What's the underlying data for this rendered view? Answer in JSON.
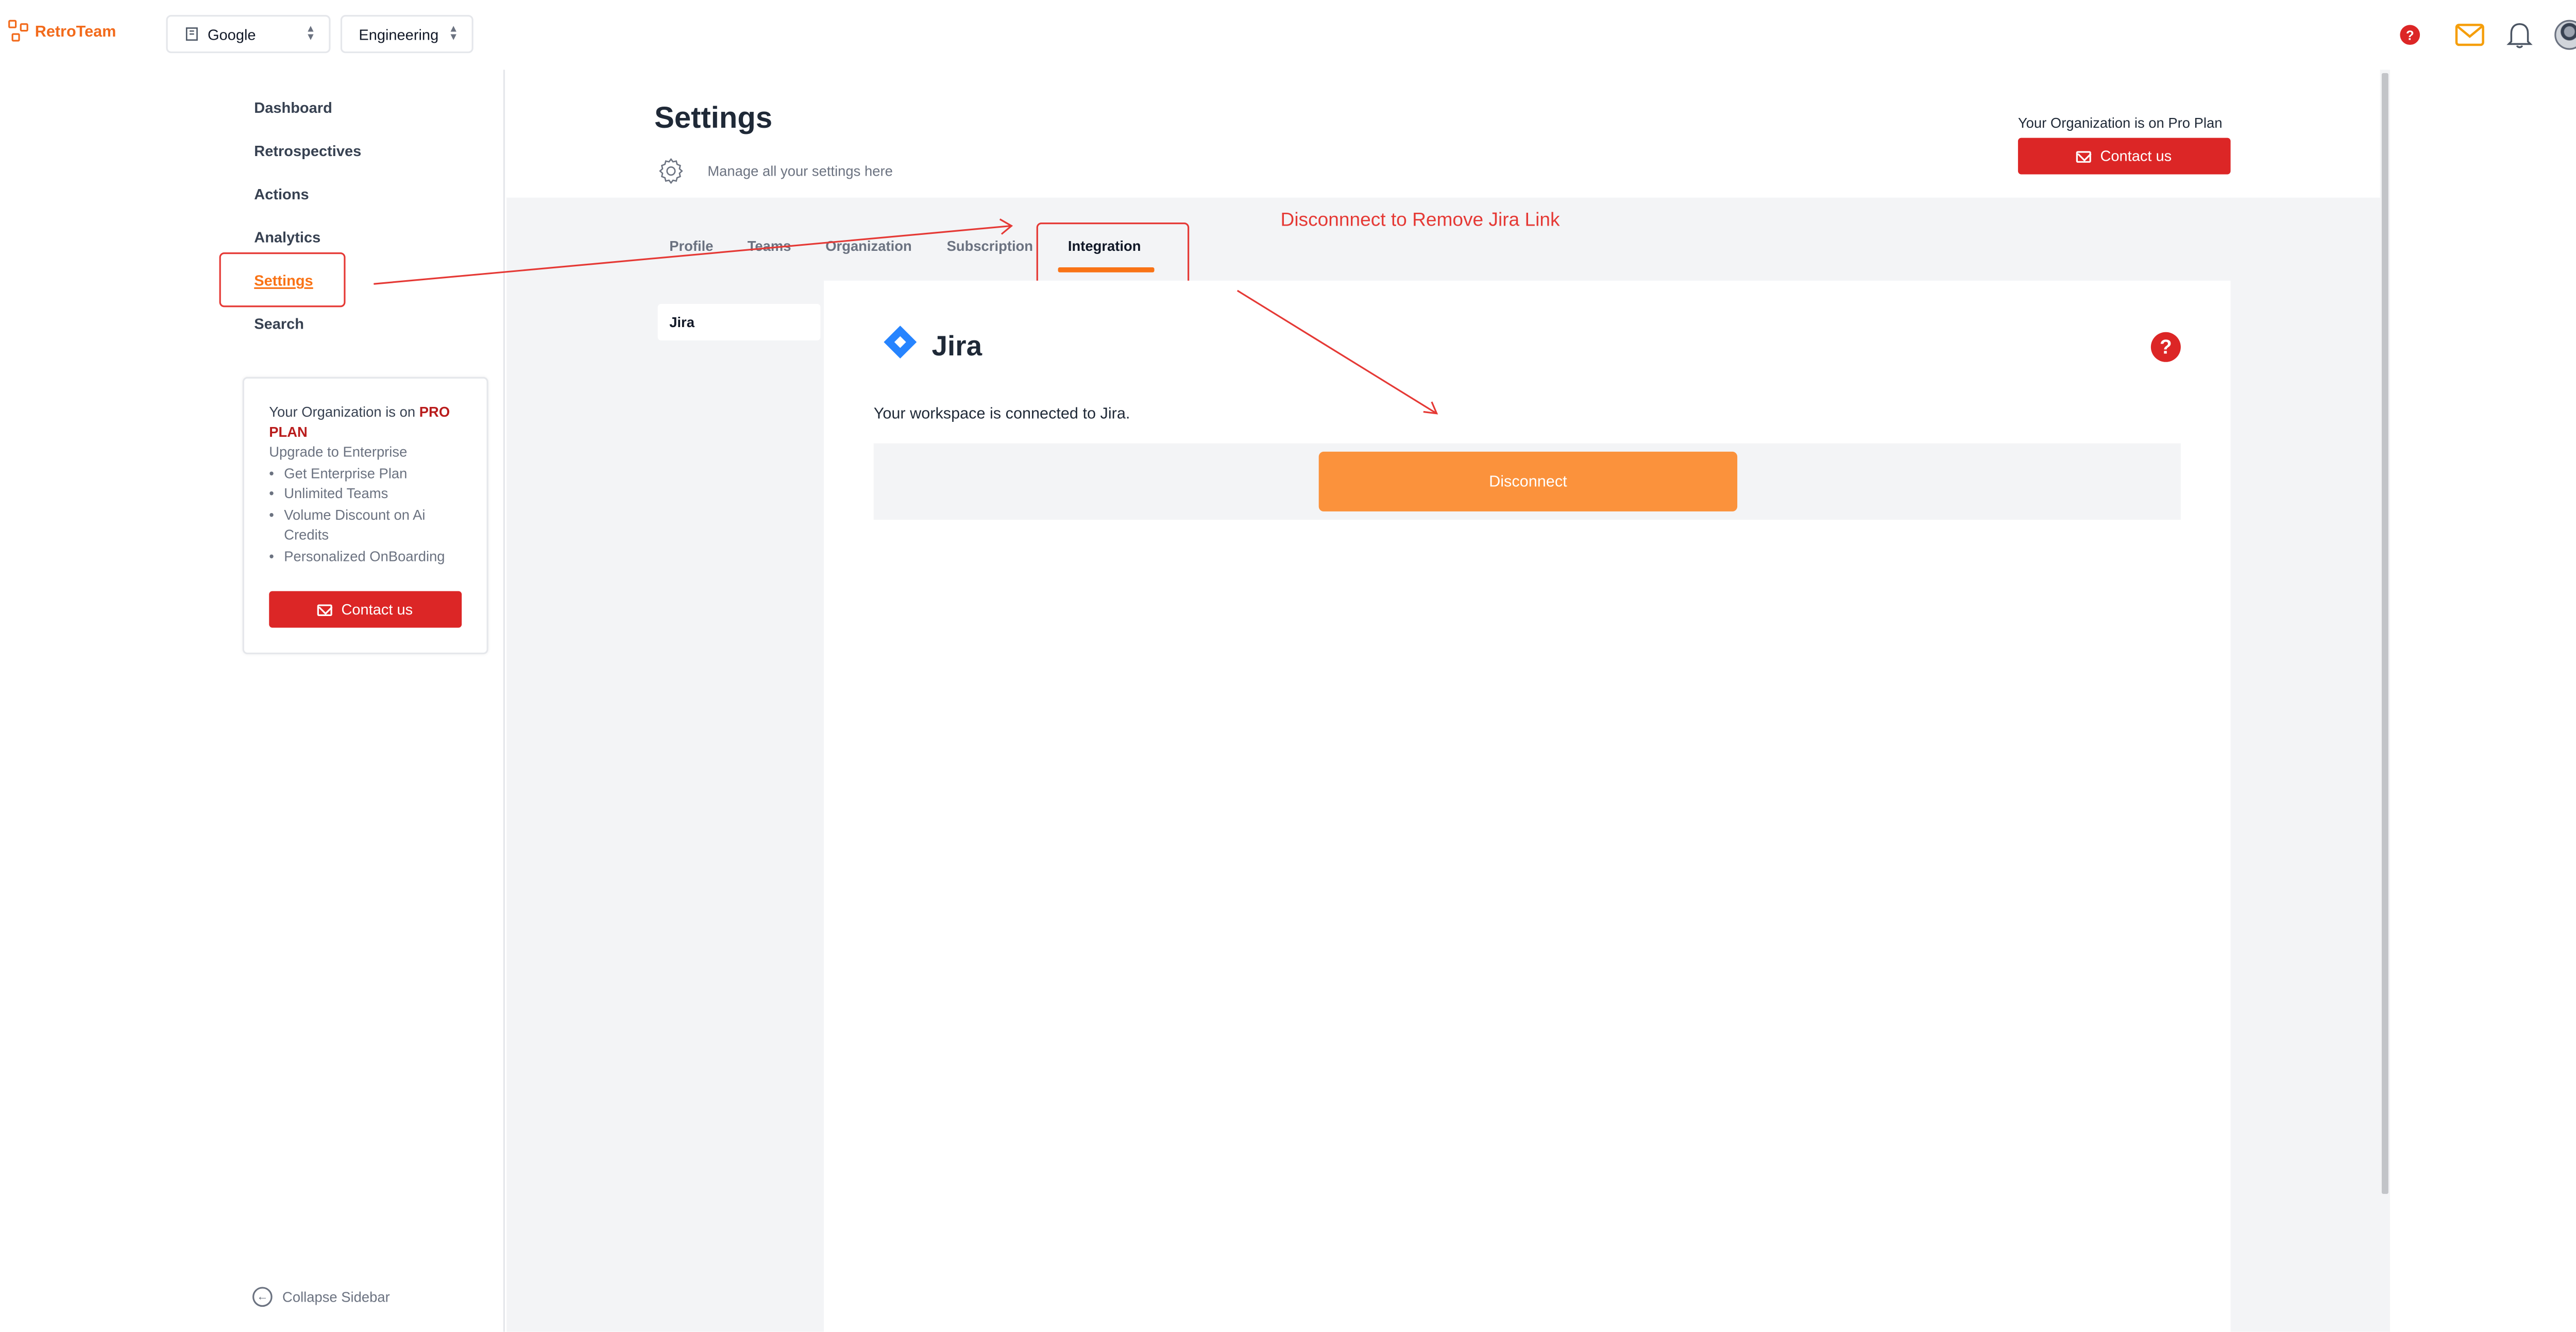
{
  "app": {
    "name": "RetroTeam"
  },
  "topbar": {
    "org_select": "Google",
    "team_select": "Engineering",
    "icons": [
      "help-icon",
      "mail-icon",
      "bell-icon",
      "avatar"
    ]
  },
  "sidebar": {
    "items": [
      {
        "label": "Dashboard"
      },
      {
        "label": "Retrospectives"
      },
      {
        "label": "Actions"
      },
      {
        "label": "Analytics"
      },
      {
        "label": "Settings",
        "active": true
      },
      {
        "label": "Search"
      }
    ],
    "promo": {
      "line_prefix": "Your Organization is on ",
      "plan": "PRO PLAN",
      "upgrade": "Upgrade to Enterprise",
      "features": [
        "Get Enterprise Plan",
        "Unlimited Teams",
        "Volume Discount on Ai Credits",
        "Personalized OnBoarding"
      ],
      "contact_label": "Contact us"
    },
    "collapse_label": "Collapse Sidebar"
  },
  "header": {
    "title": "Settings",
    "subtitle": "Manage all your settings here",
    "plan_text": "Your Organization is on Pro Plan",
    "contact_label": "Contact us"
  },
  "tabs": [
    {
      "label": "Profile"
    },
    {
      "label": "Teams"
    },
    {
      "label": "Organization"
    },
    {
      "label": "Subscription"
    },
    {
      "label": "Integration",
      "active": true
    }
  ],
  "annotation": {
    "text": "Disconnnect to Remove Jira Link",
    "color": "#e53935"
  },
  "integration": {
    "subnav_item": "Jira",
    "name": "Jira",
    "status_text": "Your workspace is connected to Jira.",
    "disconnect_label": "Disconnect"
  },
  "colors": {
    "accent": "#f97316",
    "danger": "#dc2626",
    "disconnect": "#fb923c",
    "jira": "#2684ff"
  }
}
